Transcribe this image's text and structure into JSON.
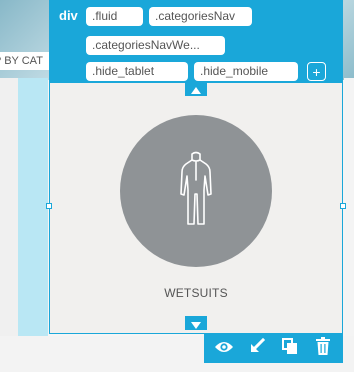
{
  "background": {
    "partial_heading": "P BY CAT"
  },
  "class_panel": {
    "tag": "div",
    "classes": [
      ".fluid",
      ".categoriesNav",
      ".categoriesNavWe...",
      ".hide_tablet",
      ".hide_mobile"
    ],
    "add_label": "+"
  },
  "selected": {
    "category_label": "WETSUITS",
    "icon": "wetsuit-icon"
  },
  "toolbar": {
    "icons": [
      "eye-icon",
      "select-parent-arrow-icon",
      "copy-icon",
      "trash-icon"
    ]
  },
  "colors": {
    "accent": "#1aa7d9",
    "circle": "#8f9396",
    "card_background": "#f1f0ee"
  }
}
